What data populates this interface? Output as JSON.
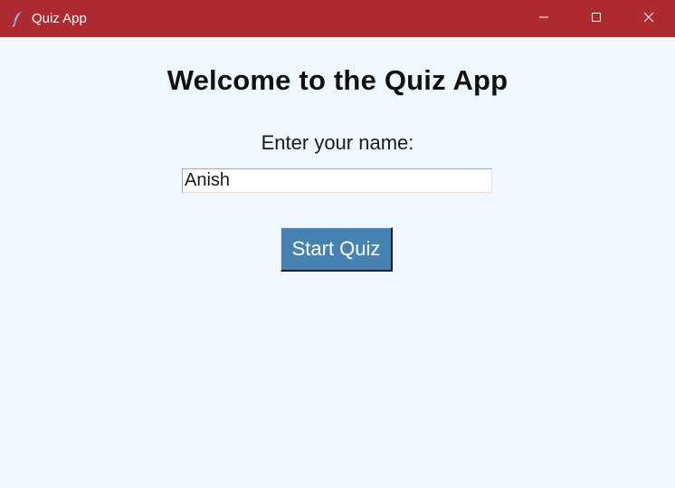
{
  "window": {
    "title": "Quiz App",
    "titlebar_color": "#ad2b30",
    "background_color": "#f0f8ff",
    "app_icon": "feather-icon",
    "controls": [
      "minimize-icon",
      "maximize-icon",
      "close-icon"
    ]
  },
  "main": {
    "heading": "Welcome to the Quiz App",
    "name_label": "Enter your name:",
    "name_value": "Anish",
    "start_button_label": "Start Quiz",
    "button_color": "#4682b4"
  }
}
